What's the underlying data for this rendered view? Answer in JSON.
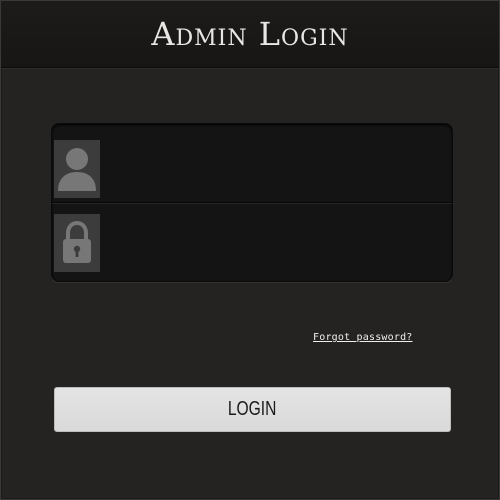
{
  "header": {
    "title": "Admin Login"
  },
  "form": {
    "username": {
      "icon": "user-icon",
      "value": "",
      "placeholder": ""
    },
    "password": {
      "icon": "lock-icon",
      "value": "",
      "placeholder": ""
    },
    "forgot_link": "Forgot password?",
    "login_button": "LOGIN"
  },
  "colors": {
    "background": "#242322",
    "header": "#1a1918",
    "field_bg": "#141414",
    "icon_bg": "#3c3c3c",
    "icon_fg": "#777777",
    "button_bg": "#dcdcdc"
  }
}
